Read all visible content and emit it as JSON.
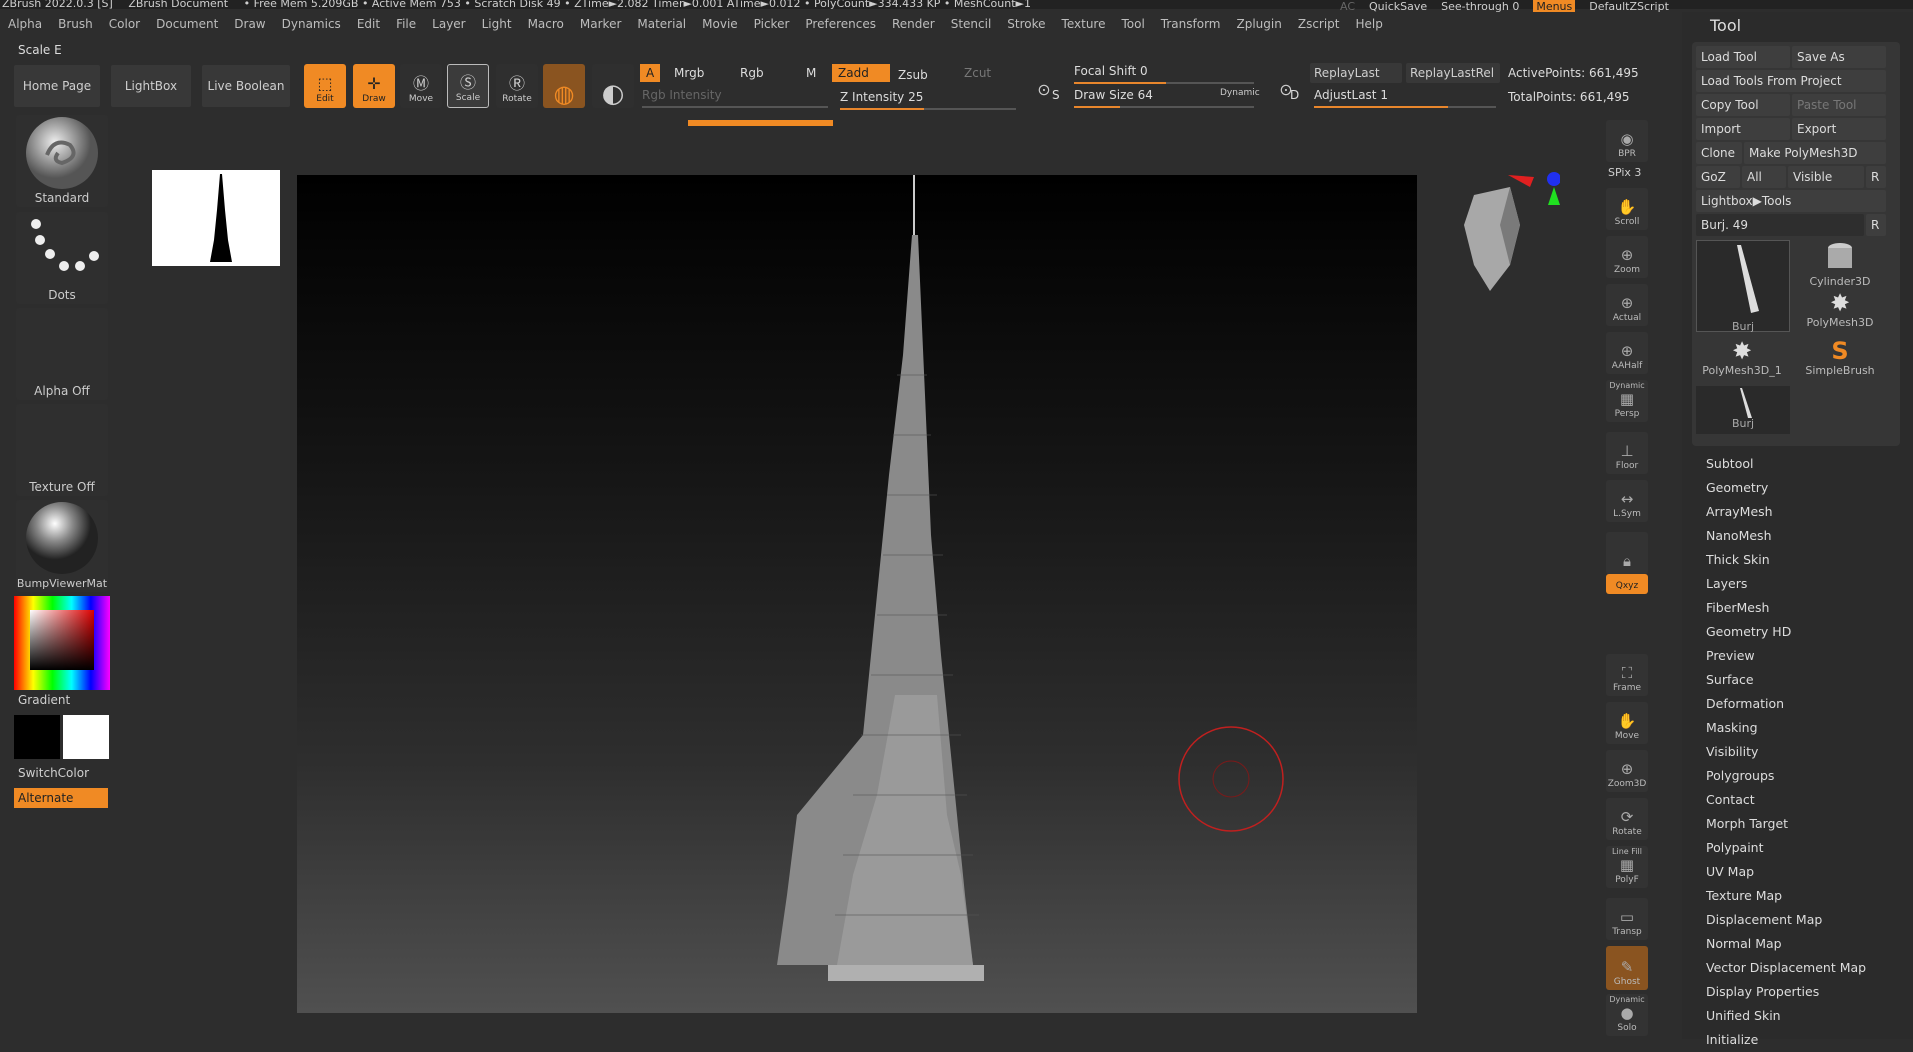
{
  "titlebar": {
    "app_title": "ZBrush 2022.0.3 [S]",
    "document": "ZBrush Document",
    "stats": "• Free Mem 5.209GB • Active Mem 753 • Scratch Disk 49 • ZTime►2.082 Timer►0.001 ATime►0.012 • PolyCount►334.433 KP • MeshCount►1",
    "ac": "AC",
    "quicksave": "QuickSave",
    "see_through": "See-through   0",
    "menus": "Menus",
    "default_zscript": "DefaultZScript"
  },
  "menubar": [
    "Alpha",
    "Brush",
    "Color",
    "Document",
    "Draw",
    "Dynamics",
    "Edit",
    "File",
    "Layer",
    "Light",
    "Macro",
    "Marker",
    "Material",
    "Movie",
    "Picker",
    "Preferences",
    "Render",
    "Stencil",
    "Stroke",
    "Texture",
    "Tool",
    "Transform",
    "Zplugin",
    "Zscript",
    "Help"
  ],
  "status": "Scale E",
  "toolbar": {
    "home": "Home Page",
    "lightbox": "LightBox",
    "live_boolean": "Live Boolean",
    "edit": "Edit",
    "draw": "Draw",
    "move": "Move",
    "scale": "Scale",
    "rotate": "Rotate",
    "a": "A",
    "mrgb": "Mrgb",
    "rgb": "Rgb",
    "m": "M",
    "zadd": "Zadd",
    "zsub": "Zsub",
    "zcut": "Zcut",
    "rgb_intensity": "Rgb Intensity",
    "z_intensity": "Z Intensity 25",
    "focal_shift": "Focal Shift 0",
    "draw_size": "Draw Size 64",
    "dynamic": "Dynamic",
    "replay_last": "ReplayLast",
    "replay_last_rel": "ReplayLastRel",
    "adjust_last": "AdjustLast 1",
    "active_points": "ActivePoints: 661,495",
    "total_points": "TotalPoints: 661,495",
    "s": "S",
    "d": "D"
  },
  "left": {
    "standard": "Standard",
    "dots": "Dots",
    "alpha_off": "Alpha Off",
    "texture_off": "Texture Off",
    "material": "BumpViewerMat",
    "gradient": "Gradient",
    "switch_color": "SwitchColor",
    "alternate": "Alternate"
  },
  "right_strip": [
    "BPR",
    "SPix 3",
    "Scroll",
    "Zoom",
    "Actual",
    "AAHalf",
    "Dynamic",
    "Persp",
    "Floor",
    "L.Sym",
    "Qxyz",
    "Frame",
    "Move",
    "Zoom3D",
    "Rotate",
    "Line Fill",
    "PolyF",
    "Transp",
    "Ghost",
    "Dynamic",
    "Solo"
  ],
  "tool_panel": {
    "title": "Tool",
    "load_tool": "Load Tool",
    "save_as": "Save As",
    "load_from_project": "Load Tools From Project",
    "copy_tool": "Copy Tool",
    "paste_tool": "Paste Tool",
    "import": "Import",
    "export": "Export",
    "clone": "Clone",
    "make_polymesh": "Make PolyMesh3D",
    "goz": "GoZ",
    "all": "All",
    "visible": "Visible",
    "r": "R",
    "lightbox_tools": "Lightbox▶Tools",
    "current_tool": "Burj. 49",
    "tools": [
      "Burj",
      "Cylinder3D",
      "PolyMesh3D",
      "PolyMesh3D_1",
      "SimpleBrush",
      "Burj"
    ],
    "menu": [
      "Subtool",
      "Geometry",
      "ArrayMesh",
      "NanoMesh",
      "Thick Skin",
      "Layers",
      "FiberMesh",
      "Geometry HD",
      "Preview",
      "Surface",
      "Deformation",
      "Masking",
      "Visibility",
      "Polygroups",
      "Contact",
      "Morph Target",
      "Polypaint",
      "UV Map",
      "Texture Map",
      "Displacement Map",
      "Normal Map",
      "Vector Displacement Map",
      "Display Properties",
      "Unified Skin",
      "Initialize"
    ]
  },
  "colors": {
    "accent": "#f08a24",
    "bg": "#2d2d2d"
  }
}
